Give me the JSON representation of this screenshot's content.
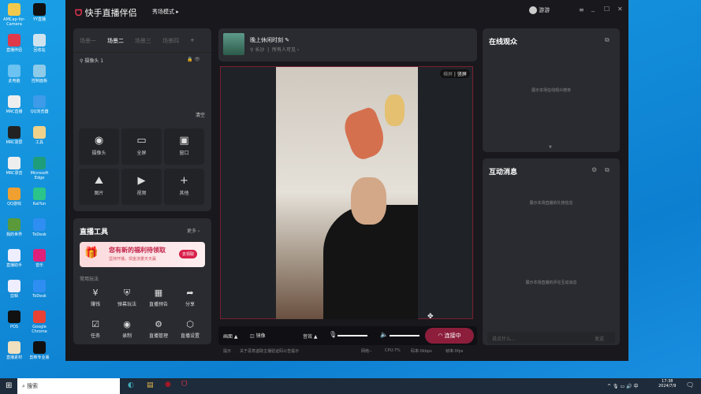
{
  "desktop": {
    "icons": [
      {
        "label": "AMCap-for-Camera",
        "color": "#f2c94c"
      },
      {
        "label": "YY直播",
        "color": "#111"
      },
      {
        "label": "直播伴侣",
        "color": "#e03a4a"
      },
      {
        "label": "回收站",
        "color": "#cfe3ef"
      },
      {
        "label": "此电脑",
        "color": "#6cc2f0"
      },
      {
        "label": "控制面板",
        "color": "#8ecbe8"
      },
      {
        "label": "MRC直播",
        "color": "#eee"
      },
      {
        "label": "QQ浏览器",
        "color": "#3d9be9"
      },
      {
        "label": "MRC录屏",
        "color": "#222"
      },
      {
        "label": "工具",
        "color": "#f1d28a"
      },
      {
        "label": "MRC录音",
        "color": "#eee"
      },
      {
        "label": "Microsoft Edge",
        "color": "#1e9d7a"
      },
      {
        "label": "QQ游戏",
        "color": "#f0a030"
      },
      {
        "label": "KaiYun",
        "color": "#2bc48a"
      },
      {
        "label": "我的世界",
        "color": "#5a9a3a"
      },
      {
        "label": "ToDesk",
        "color": "#2f8ef2"
      },
      {
        "label": "直播助手",
        "color": "#eef"
      },
      {
        "label": "音乐",
        "color": "#e0207a"
      },
      {
        "label": "剪辑",
        "color": "#eef"
      },
      {
        "label": "ToDesk",
        "color": "#2f8ef2"
      },
      {
        "label": "POS",
        "color": "#111"
      },
      {
        "label": "Google Chrome",
        "color": "#e94235"
      },
      {
        "label": "直播素材",
        "color": "#f0e0c0"
      },
      {
        "label": "剪映专业版",
        "color": "#111"
      }
    ]
  },
  "app": {
    "name": "快手直播伴侣",
    "mode": "秀场模式",
    "user": "游游",
    "accent": "#c2244a"
  },
  "scenes": {
    "tabs": [
      "场景一",
      "场景二",
      "场景三",
      "场景四"
    ],
    "active": 1,
    "add": "+",
    "source": "摄像头 1",
    "clear": "清空",
    "tiles": [
      {
        "icon": "◉",
        "label": "摄像头"
      },
      {
        "icon": "▭",
        "label": "全屏"
      },
      {
        "icon": "▣",
        "label": "窗口"
      },
      {
        "icon": "⛰",
        "label": "图片"
      },
      {
        "icon": "▶",
        "label": "视频"
      },
      {
        "icon": "+",
        "label": "其他"
      }
    ]
  },
  "tools": {
    "title": "直播工具",
    "more": "更多 ›",
    "banner": {
      "title": "您有新的福利待领取",
      "subtitle": "坚持开播，现金流量天天赢",
      "button": "去领取"
    },
    "section": "常用玩法",
    "items": [
      {
        "icon": "¥",
        "label": "赚钱"
      },
      {
        "icon": "⛨",
        "label": "弹幕玩法"
      },
      {
        "icon": "▦",
        "label": "直播预告"
      },
      {
        "icon": "➦",
        "label": "分享"
      },
      {
        "icon": "☑",
        "label": "任务"
      },
      {
        "icon": "◉",
        "label": "录制"
      },
      {
        "icon": "⚙",
        "label": "直播管理"
      },
      {
        "icon": "⬡",
        "label": "直播设置"
      }
    ]
  },
  "stream": {
    "title": "晚上休闲时刻",
    "location": "长沙",
    "visibility": "所有人可见 ›",
    "orient": [
      "横屏",
      "竖屏"
    ]
  },
  "controls": {
    "picture": "画面",
    "mirror": "镜像",
    "effects": "音效",
    "mic_level": 100,
    "speaker_level": 100,
    "connect": "连接中"
  },
  "status": {
    "hint": "提示",
    "notice": "关于恶意盗取主播验证码公告提示",
    "network": "网络--",
    "cpu": "CPU:7%",
    "bitrate": "码率:0kbps",
    "fps": "帧率:0fps"
  },
  "audience": {
    "title": "在线观众",
    "empty": "展示本场在线观众榜单"
  },
  "messages": {
    "title": "互动消息",
    "gift_empty": "展示本场直播的礼物信息",
    "comment_empty": "展示本场直播的评论互动消息",
    "placeholder": "说点什么...",
    "send": "发送"
  },
  "taskbar": {
    "search": "搜索",
    "time": "17:38",
    "date": "2024/7/9",
    "ime": "中"
  }
}
